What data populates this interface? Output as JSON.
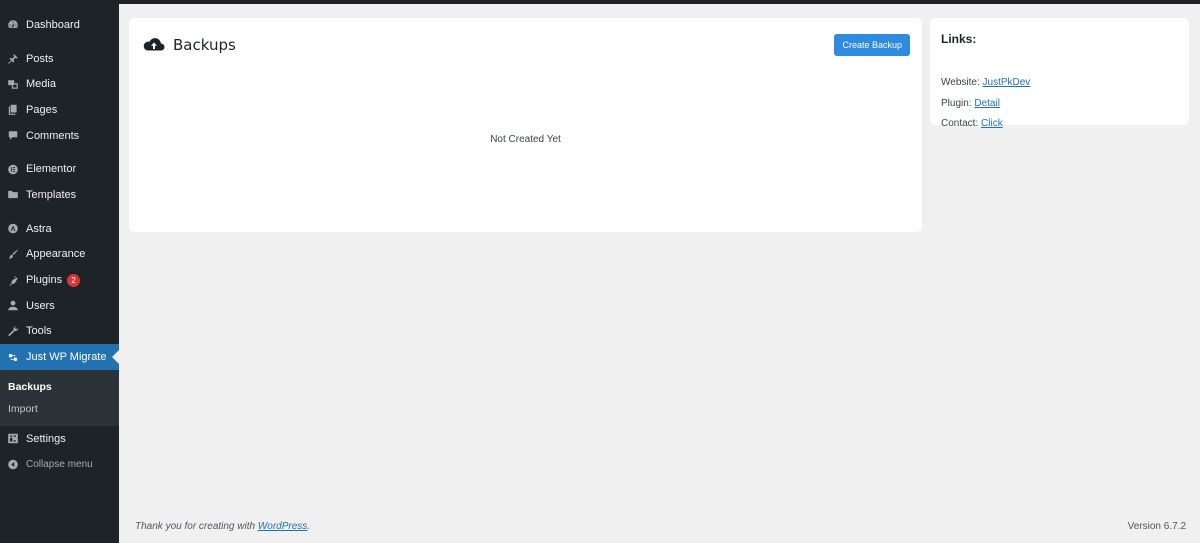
{
  "sidebar": {
    "items": [
      {
        "label": "Dashboard",
        "icon": "dashboard-icon"
      },
      {
        "label": "Posts",
        "icon": "pin-icon"
      },
      {
        "label": "Media",
        "icon": "media-icon"
      },
      {
        "label": "Pages",
        "icon": "pages-icon"
      },
      {
        "label": "Comments",
        "icon": "comment-icon"
      },
      {
        "label": "Elementor",
        "icon": "elementor-icon"
      },
      {
        "label": "Templates",
        "icon": "folder-icon"
      },
      {
        "label": "Astra",
        "icon": "astra-icon"
      },
      {
        "label": "Appearance",
        "icon": "brush-icon"
      },
      {
        "label": "Plugins",
        "icon": "plugin-icon",
        "badge": "2"
      },
      {
        "label": "Users",
        "icon": "user-icon"
      },
      {
        "label": "Tools",
        "icon": "wrench-icon"
      },
      {
        "label": "Just WP Migrate",
        "icon": "migrate-icon",
        "active": true
      },
      {
        "label": "Settings",
        "icon": "settings-icon"
      },
      {
        "label": "Collapse menu",
        "icon": "collapse-icon"
      }
    ],
    "submenu": [
      {
        "label": "Backups",
        "current": true
      },
      {
        "label": "Import"
      }
    ]
  },
  "backups": {
    "title": "Backups",
    "create_label": "Create Backup",
    "empty_text": "Not Created Yet"
  },
  "links": {
    "title": "Links:",
    "website_label": "Website:",
    "website_link": "JustPkDev",
    "plugin_label": "Plugin:",
    "plugin_link": "Detail",
    "contact_label": "Contact:",
    "contact_link": "Click"
  },
  "footer": {
    "thanks_prefix": "Thank you for creating with ",
    "thanks_link": "WordPress",
    "thanks_suffix": ".",
    "version": "Version 6.7.2"
  },
  "colors": {
    "sidebar_bg": "#1d2327",
    "accent": "#2271b1",
    "button": "#2e8bde",
    "badge": "#d63638"
  }
}
